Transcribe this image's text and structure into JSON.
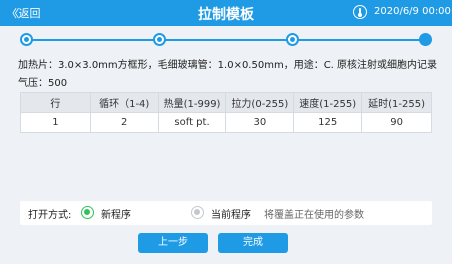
{
  "header": {
    "back_label": "返回",
    "title": "拉制模板",
    "datetime": "2020/6/9  00:00"
  },
  "steps": {
    "count": 4,
    "current": 4
  },
  "info": {
    "line1": "加热片：3.0×3.0mm方框形，毛细玻璃管：1.0×0.50mm，用途：C. 原核注射或细胞内记录",
    "line2": "气压：500"
  },
  "table": {
    "headers": [
      "行",
      "循环（1-4)",
      "热量(1-999)",
      "拉力(0-255)",
      "速度(1-255)",
      "延时(1-255)"
    ],
    "rows": [
      [
        "1",
        "2",
        "soft pt.",
        "30",
        "125",
        "90"
      ]
    ]
  },
  "open_mode": {
    "label": "打开方式:",
    "new_program": "新程序",
    "current_program": "当前程序",
    "hint": "将覆盖正在使用的参数",
    "selected": "new_program"
  },
  "buttons": {
    "prev": "上一步",
    "finish": "完成"
  },
  "colors": {
    "accent": "#1f9be6",
    "radio_on": "#32c25a",
    "radio_off": "#c4c8cd"
  }
}
